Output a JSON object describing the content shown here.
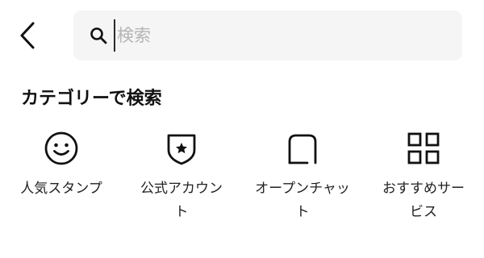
{
  "header": {
    "back_icon": "chevron-left-icon"
  },
  "search": {
    "icon": "search-icon",
    "placeholder": "検索",
    "value": ""
  },
  "section": {
    "title": "カテゴリーで検索"
  },
  "categories": [
    {
      "icon": "smiley-face-icon",
      "label": "人気スタンプ"
    },
    {
      "icon": "shield-star-icon",
      "label": "公式アカウント"
    },
    {
      "icon": "chat-bubble-icon",
      "label": "オープンチャット"
    },
    {
      "icon": "grid-icon",
      "label": "おすすめサービス"
    }
  ]
}
